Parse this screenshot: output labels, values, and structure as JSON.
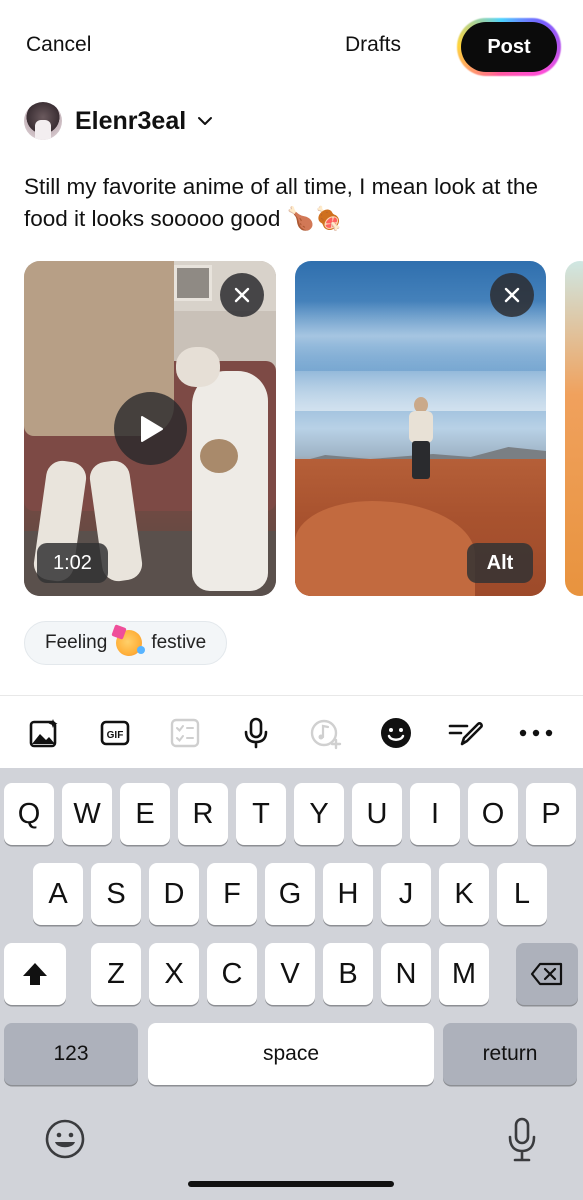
{
  "header": {
    "cancel_label": "Cancel",
    "drafts_label": "Drafts",
    "post_label": "Post"
  },
  "account": {
    "username": "Elenr3eal"
  },
  "post": {
    "text": "Still my favorite anime of all time, I mean look at the food it looks sooooo good 🍗🍖"
  },
  "media": [
    {
      "type": "video",
      "duration": "1:02"
    },
    {
      "type": "image",
      "alt_label": "Alt"
    }
  ],
  "feeling": {
    "prefix": "Feeling",
    "value": "festive"
  },
  "toolbar": {
    "icons": [
      "image-add-icon",
      "gif-icon",
      "checklist-icon",
      "microphone-icon",
      "music-add-icon",
      "emoji-icon",
      "draw-icon",
      "more-icon"
    ]
  },
  "keyboard": {
    "row1": [
      "Q",
      "W",
      "E",
      "R",
      "T",
      "Y",
      "U",
      "I",
      "O",
      "P"
    ],
    "row2": [
      "A",
      "S",
      "D",
      "F",
      "G",
      "H",
      "J",
      "K",
      "L"
    ],
    "row3": [
      "Z",
      "X",
      "C",
      "V",
      "B",
      "N",
      "M"
    ],
    "numbers_label": "123",
    "space_label": "space",
    "return_label": "return"
  },
  "colors": {
    "post_button_bg": "#0b0b0b",
    "keyboard_bg": "#d1d3d9",
    "key_bg": "#ffffff",
    "key_dark_bg": "#adb1bb"
  }
}
